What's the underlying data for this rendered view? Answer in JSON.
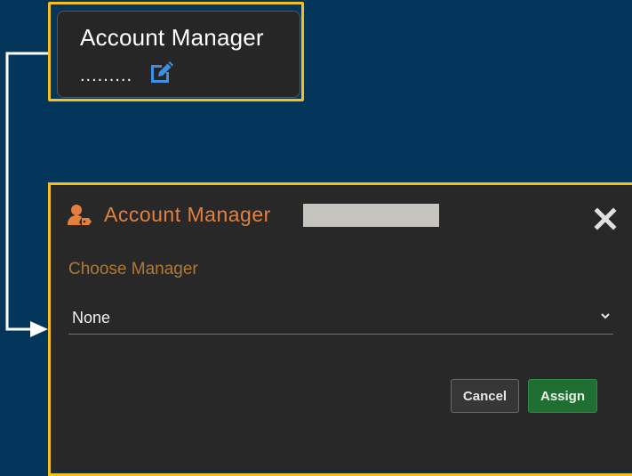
{
  "card": {
    "title": "Account Manager",
    "value": ".........",
    "edit_icon": "edit-icon"
  },
  "modal": {
    "icon": "user-tag-icon",
    "title": "Account Manager",
    "close_icon": "close-icon",
    "field_label": "Choose Manager",
    "select_value": "None",
    "chevron_icon": "chevron-down-icon",
    "cancel_label": "Cancel",
    "assign_label": "Assign"
  },
  "colors": {
    "background": "#04355a",
    "highlight": "#f6bf1a",
    "modal_title": "#e4803f",
    "assign": "#1f6f32"
  }
}
